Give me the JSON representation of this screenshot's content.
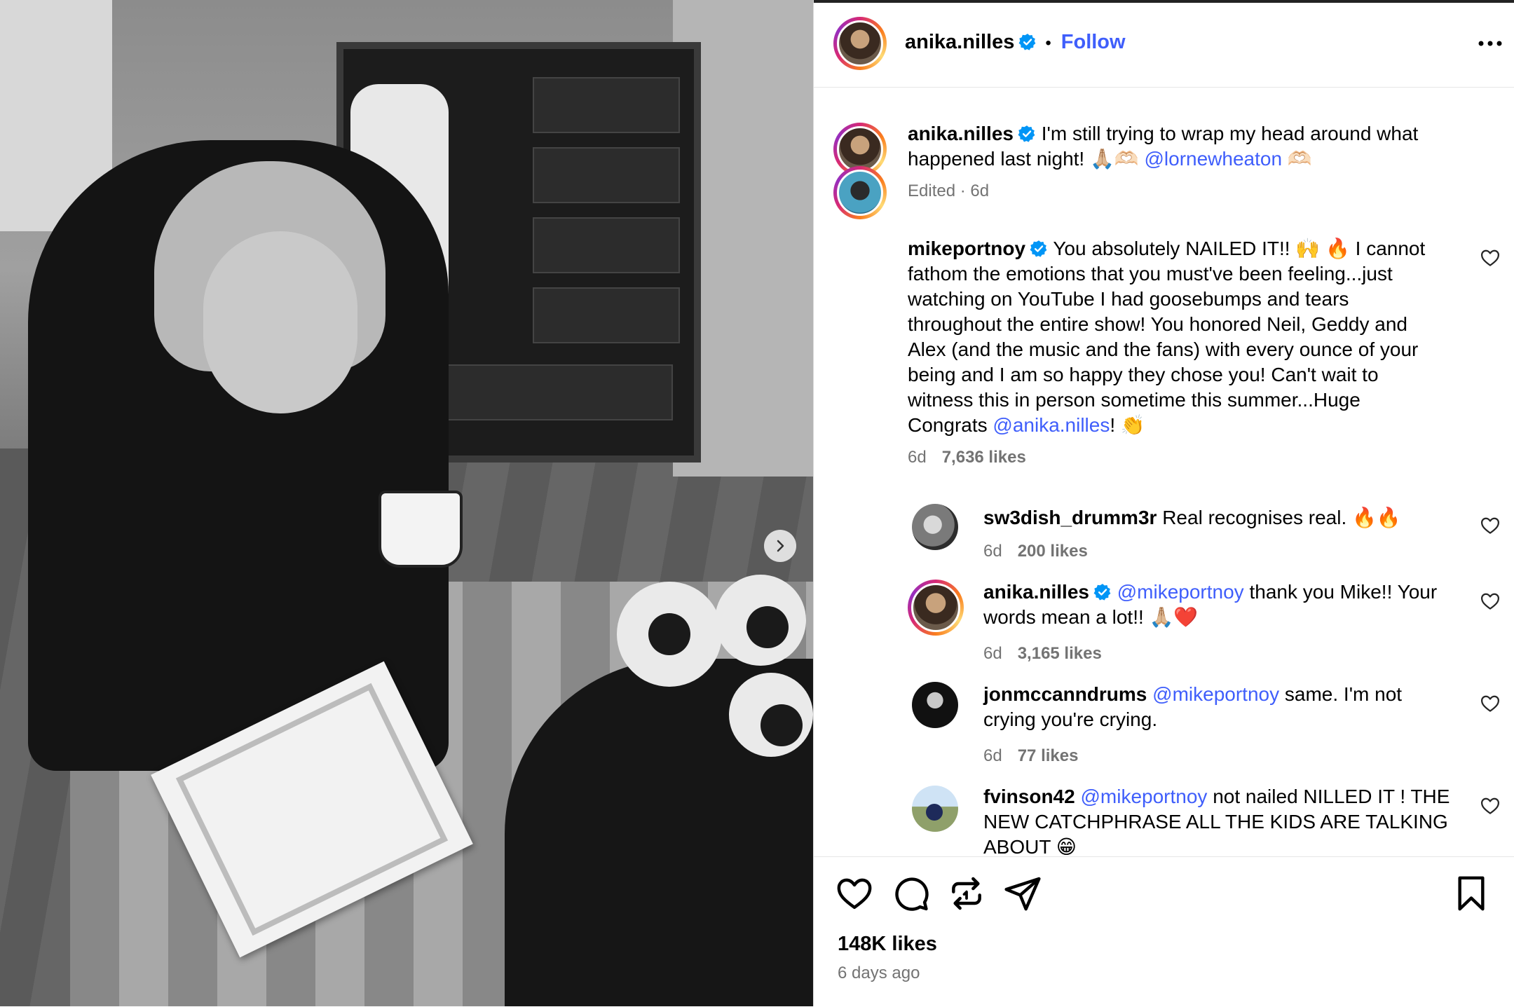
{
  "post": {
    "author": "anika.nilles",
    "follow_label": "Follow",
    "caption_author": "anika.nilles",
    "caption_text_1": "I'm still trying to wrap my head around what",
    "caption_text_2": "happened last night! 🙏🏼🫶🏻",
    "caption_mention": "@lornewheaton",
    "caption_emoji_end": "🫶🏻",
    "caption_meta": "Edited · 6d",
    "likes": "148K likes",
    "date": "6 days ago"
  },
  "comments": [
    {
      "user": "mikeportnoy",
      "lines": [
        "You absolutely NAILED IT!! 🙌 🔥 I cannot",
        "fathom the emotions that you must've been feeling...just",
        "watching on YouTube I had goosebumps and tears",
        "throughout the entire show! You honored Neil, Geddy and",
        "Alex (and the music and the fans) with every ounce of your",
        "being and I am so happy they chose you! Can't wait to",
        "witness this in person sometime this summer...Huge"
      ],
      "last_prefix": "Congrats ",
      "last_mention": "@anika.nilles",
      "last_suffix": "! 👏",
      "time": "6d",
      "likes": "7,636 likes"
    },
    {
      "user": "sw3dish_drumm3r",
      "text": "Real recognises real. 🔥🔥",
      "time": "6d",
      "likes": "200 likes"
    },
    {
      "user": "anika.nilles",
      "mention": "@mikeportnoy",
      "text_1": " thank you Mike!! Your",
      "text_2": "words mean a lot!! 🙏🏼❤️",
      "time": "6d",
      "likes": "3,165 likes"
    },
    {
      "user": "jonmccanndrums",
      "mention": "@mikeportnoy",
      "text_1": " same. I'm not",
      "text_2": "crying you're crying.",
      "time": "6d",
      "likes": "77 likes"
    },
    {
      "user": "fvinson42",
      "mention": "@mikeportnoy",
      "text_1": " not nailed NILLED IT ! THE",
      "text_2": "NEW CATCHPHRASE ALL THE KIDS ARE TALKING",
      "text_3": "ABOUT 😁"
    }
  ],
  "icons": {
    "verified": "verified-badge-icon",
    "more": "more-options-icon",
    "like": "heart-icon",
    "comment": "comment-icon",
    "repost": "repost-icon",
    "share": "share-icon",
    "save": "bookmark-icon",
    "next": "chevron-right-icon"
  },
  "colors": {
    "accent": "#3f5efb",
    "verified": "#0095f6",
    "muted": "#737373"
  }
}
